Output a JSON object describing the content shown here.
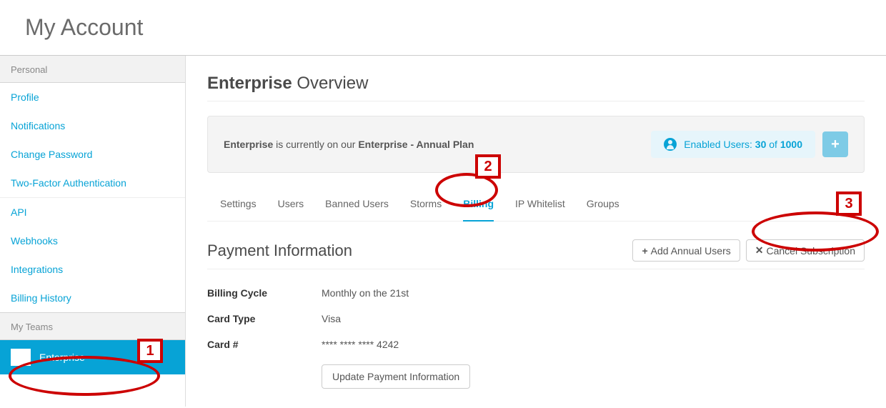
{
  "header": {
    "title": "My Account"
  },
  "sidebar": {
    "section_personal": "Personal",
    "items_personal": [
      {
        "label": "Profile"
      },
      {
        "label": "Notifications"
      },
      {
        "label": "Change Password"
      },
      {
        "label": "Two-Factor Authentication"
      },
      {
        "label": "API"
      },
      {
        "label": "Webhooks"
      },
      {
        "label": "Integrations"
      },
      {
        "label": "Billing History"
      }
    ],
    "section_teams": "My Teams",
    "teams": [
      {
        "label": "Enterprise"
      }
    ]
  },
  "main": {
    "title_bold": "Enterprise",
    "title_rest": " Overview",
    "plan": {
      "org_bold": "Enterprise",
      "mid": " is currently on our ",
      "plan_bold": "Enterprise - Annual Plan"
    },
    "enabled": {
      "prefix": "Enabled Users: ",
      "count": "30",
      "of": " of ",
      "total": "1000"
    },
    "tabs": [
      {
        "label": "Settings"
      },
      {
        "label": "Users"
      },
      {
        "label": "Banned Users"
      },
      {
        "label": "Storms"
      },
      {
        "label": "Billing",
        "active": true
      },
      {
        "label": "IP Whitelist"
      },
      {
        "label": "Groups"
      }
    ],
    "section_title": "Payment Information",
    "buttons": {
      "add_users": "Add Annual Users",
      "cancel_sub": "Cancel Subscription",
      "update": "Update Payment Information"
    },
    "info": [
      {
        "label": "Billing Cycle",
        "value": "Monthly on the 21st"
      },
      {
        "label": "Card Type",
        "value": "Visa"
      },
      {
        "label": "Card #",
        "value": "**** **** **** 4242"
      }
    ]
  },
  "callouts": {
    "c1": "1",
    "c2": "2",
    "c3": "3"
  }
}
